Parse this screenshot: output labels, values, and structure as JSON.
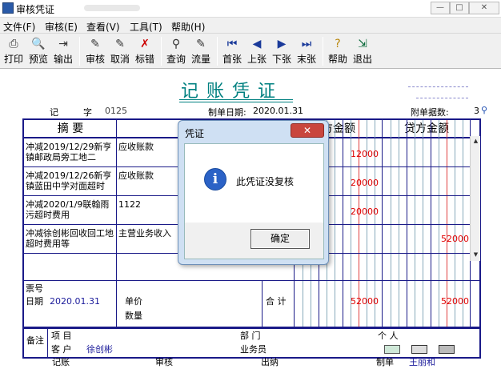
{
  "window": {
    "title": "审核凭证"
  },
  "menu": [
    "文件(F)",
    "审核(E)",
    "查看(V)",
    "工具(T)",
    "帮助(H)"
  ],
  "toolbar": {
    "print": "打印",
    "preview": "预览",
    "export": "输出",
    "audit": "审核",
    "cancel": "取消",
    "mark_error": "标错",
    "query": "查询",
    "flow": "流量",
    "first": "首张",
    "prev": "上张",
    "next": "下张",
    "last": "末张",
    "help": "帮助",
    "exit": "退出"
  },
  "voucher": {
    "title": "记账凭证",
    "type_label": "记",
    "char_label": "字",
    "number": "0125",
    "date_label": "制单日期:",
    "date": "2020.01.31",
    "attach_label": "附单据数:",
    "attach_count": "3",
    "col_summary": "摘 要",
    "col_debit": "方金额",
    "col_credit": "贷方金额",
    "rows": [
      {
        "summary": "冲减2019/12/29新亨镇邮政局旁工地二",
        "account": "应收账款",
        "debit": "12000",
        "credit": ""
      },
      {
        "summary": "冲减2019/12/26新亨镇蓝田中学对面超时",
        "account": "应收账款",
        "debit": "20000",
        "credit": ""
      },
      {
        "summary": "冲减2020/1/9联翰雨污超时费用",
        "account": "1122",
        "debit": "20000",
        "credit": ""
      },
      {
        "summary": "冲减徐创彬回收回工地超时费用等",
        "account": "主营业务收入",
        "debit": "",
        "credit": "52000"
      }
    ],
    "ticket_label": "票号",
    "ticket_date_label": "日期",
    "ticket_date": "2020.01.31",
    "unit_price_label": "单价",
    "quantity_label": "数量",
    "total_label": "合 计",
    "total_debit": "52000",
    "total_credit": "52000",
    "remark_label": "备注",
    "project_label": "项 目",
    "dept_label": "部 门",
    "person_label": "个 人",
    "customer_label": "客 户",
    "customer": "徐创彬",
    "salesman_label": "业务员",
    "bookkeeper_label": "记账",
    "auditor_label": "审核",
    "cashier_label": "出纳",
    "maker_label": "制单",
    "maker": "王丽和"
  },
  "dialog": {
    "title": "凭证",
    "close": "✕",
    "message": "此凭证没复核",
    "ok": "确定"
  }
}
